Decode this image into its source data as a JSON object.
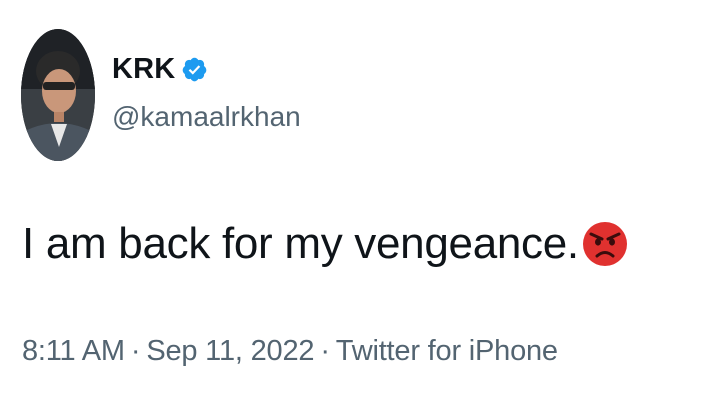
{
  "tweet": {
    "author": {
      "display_name": "KRK",
      "handle": "@kamaalrkhan",
      "verified_icon": "verified-badge-icon",
      "avatar_icon": "profile-avatar"
    },
    "text": "I am back for my vengeance.",
    "emoji_icon": "angry-face-emoji-icon",
    "meta": {
      "time": "8:11 AM",
      "date": "Sep 11, 2022",
      "source": "Twitter for iPhone",
      "separator": "·"
    }
  },
  "colors": {
    "primary_text": "#0f1419",
    "secondary_text": "#536471",
    "verified_blue": "#1d9bf0",
    "emoji_red": "#e0312f"
  }
}
